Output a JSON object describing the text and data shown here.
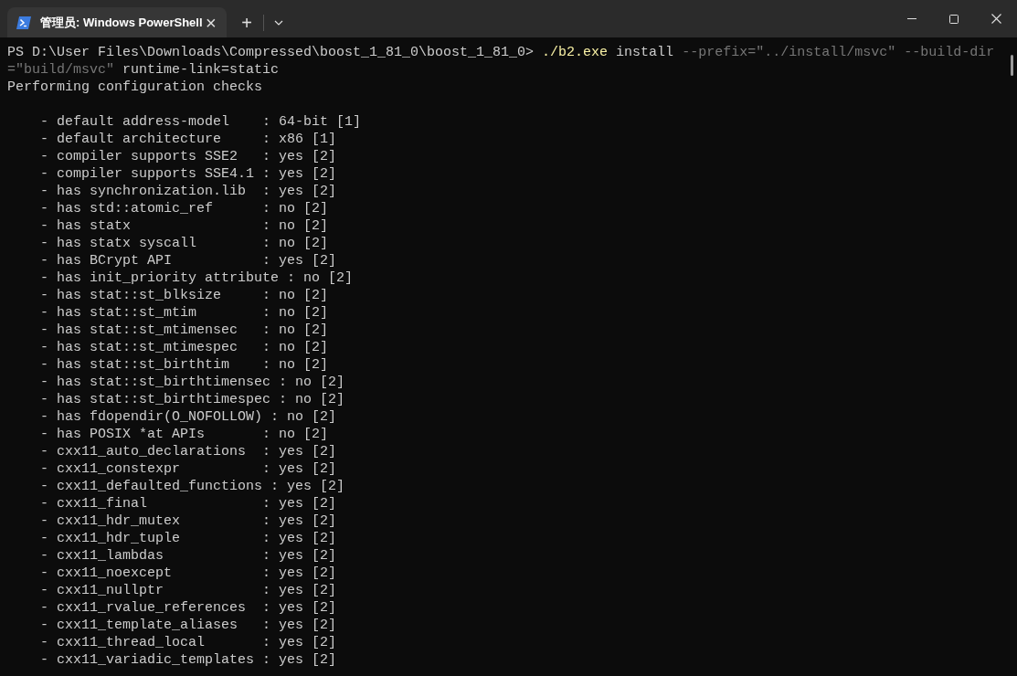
{
  "window": {
    "tab_title": "管理员: Windows PowerShell",
    "tab_close": "×",
    "new_tab": "+"
  },
  "terminal": {
    "lines": [
      {
        "kind": "text",
        "segments": [
          {
            "kind": "prompt",
            "text": "PS D:\\User Files\\Downloads\\Compressed\\boost_1_81_0\\boost_1_81_0>"
          },
          {
            "kind": "command",
            "text": "./b2.exe"
          },
          {
            "kind": "argument",
            "text": "install"
          },
          {
            "kind": "parameter",
            "text": "--prefix=\"../install/msvc\" --build-dir"
          }
        ]
      },
      {
        "kind": "text",
        "segments": [
          {
            "kind": "parameter",
            "text": "=\"build/msvc\""
          },
          {
            "kind": "argument",
            "text": "runtime-link=static"
          }
        ]
      },
      {
        "kind": "text",
        "segments": [
          {
            "kind": "output",
            "text": "Performing configuration checks"
          }
        ]
      },
      {
        "kind": "blank"
      },
      {
        "kind": "text",
        "segments": [
          {
            "kind": "output",
            "text": "    - default address-model    : 64-bit [1]"
          }
        ]
      },
      {
        "kind": "text",
        "segments": [
          {
            "kind": "output",
            "text": "    - default architecture     : x86 [1]"
          }
        ]
      },
      {
        "kind": "text",
        "segments": [
          {
            "kind": "output",
            "text": "    - compiler supports SSE2   : yes [2]"
          }
        ]
      },
      {
        "kind": "text",
        "segments": [
          {
            "kind": "output",
            "text": "    - compiler supports SSE4.1 : yes [2]"
          }
        ]
      },
      {
        "kind": "text",
        "segments": [
          {
            "kind": "output",
            "text": "    - has synchronization.lib  : yes [2]"
          }
        ]
      },
      {
        "kind": "text",
        "segments": [
          {
            "kind": "output",
            "text": "    - has std::atomic_ref      : no [2]"
          }
        ]
      },
      {
        "kind": "text",
        "segments": [
          {
            "kind": "output",
            "text": "    - has statx                : no [2]"
          }
        ]
      },
      {
        "kind": "text",
        "segments": [
          {
            "kind": "output",
            "text": "    - has statx syscall        : no [2]"
          }
        ]
      },
      {
        "kind": "text",
        "segments": [
          {
            "kind": "output",
            "text": "    - has BCrypt API           : yes [2]"
          }
        ]
      },
      {
        "kind": "text",
        "segments": [
          {
            "kind": "output",
            "text": "    - has init_priority attribute : no [2]"
          }
        ]
      },
      {
        "kind": "text",
        "segments": [
          {
            "kind": "output",
            "text": "    - has stat::st_blksize     : no [2]"
          }
        ]
      },
      {
        "kind": "text",
        "segments": [
          {
            "kind": "output",
            "text": "    - has stat::st_mtim        : no [2]"
          }
        ]
      },
      {
        "kind": "text",
        "segments": [
          {
            "kind": "output",
            "text": "    - has stat::st_mtimensec   : no [2]"
          }
        ]
      },
      {
        "kind": "text",
        "segments": [
          {
            "kind": "output",
            "text": "    - has stat::st_mtimespec   : no [2]"
          }
        ]
      },
      {
        "kind": "text",
        "segments": [
          {
            "kind": "output",
            "text": "    - has stat::st_birthtim    : no [2]"
          }
        ]
      },
      {
        "kind": "text",
        "segments": [
          {
            "kind": "output",
            "text": "    - has stat::st_birthtimensec : no [2]"
          }
        ]
      },
      {
        "kind": "text",
        "segments": [
          {
            "kind": "output",
            "text": "    - has stat::st_birthtimespec : no [2]"
          }
        ]
      },
      {
        "kind": "text",
        "segments": [
          {
            "kind": "output",
            "text": "    - has fdopendir(O_NOFOLLOW) : no [2]"
          }
        ]
      },
      {
        "kind": "text",
        "segments": [
          {
            "kind": "output",
            "text": "    - has POSIX *at APIs       : no [2]"
          }
        ]
      },
      {
        "kind": "text",
        "segments": [
          {
            "kind": "output",
            "text": "    - cxx11_auto_declarations  : yes [2]"
          }
        ]
      },
      {
        "kind": "text",
        "segments": [
          {
            "kind": "output",
            "text": "    - cxx11_constexpr          : yes [2]"
          }
        ]
      },
      {
        "kind": "text",
        "segments": [
          {
            "kind": "output",
            "text": "    - cxx11_defaulted_functions : yes [2]"
          }
        ]
      },
      {
        "kind": "text",
        "segments": [
          {
            "kind": "output",
            "text": "    - cxx11_final              : yes [2]"
          }
        ]
      },
      {
        "kind": "text",
        "segments": [
          {
            "kind": "output",
            "text": "    - cxx11_hdr_mutex          : yes [2]"
          }
        ]
      },
      {
        "kind": "text",
        "segments": [
          {
            "kind": "output",
            "text": "    - cxx11_hdr_tuple          : yes [2]"
          }
        ]
      },
      {
        "kind": "text",
        "segments": [
          {
            "kind": "output",
            "text": "    - cxx11_lambdas            : yes [2]"
          }
        ]
      },
      {
        "kind": "text",
        "segments": [
          {
            "kind": "output",
            "text": "    - cxx11_noexcept           : yes [2]"
          }
        ]
      },
      {
        "kind": "text",
        "segments": [
          {
            "kind": "output",
            "text": "    - cxx11_nullptr            : yes [2]"
          }
        ]
      },
      {
        "kind": "text",
        "segments": [
          {
            "kind": "output",
            "text": "    - cxx11_rvalue_references  : yes [2]"
          }
        ]
      },
      {
        "kind": "text",
        "segments": [
          {
            "kind": "output",
            "text": "    - cxx11_template_aliases   : yes [2]"
          }
        ]
      },
      {
        "kind": "text",
        "segments": [
          {
            "kind": "output",
            "text": "    - cxx11_thread_local       : yes [2]"
          }
        ]
      },
      {
        "kind": "text",
        "segments": [
          {
            "kind": "output",
            "text": "    - cxx11_variadic_templates : yes [2]"
          }
        ]
      }
    ]
  }
}
